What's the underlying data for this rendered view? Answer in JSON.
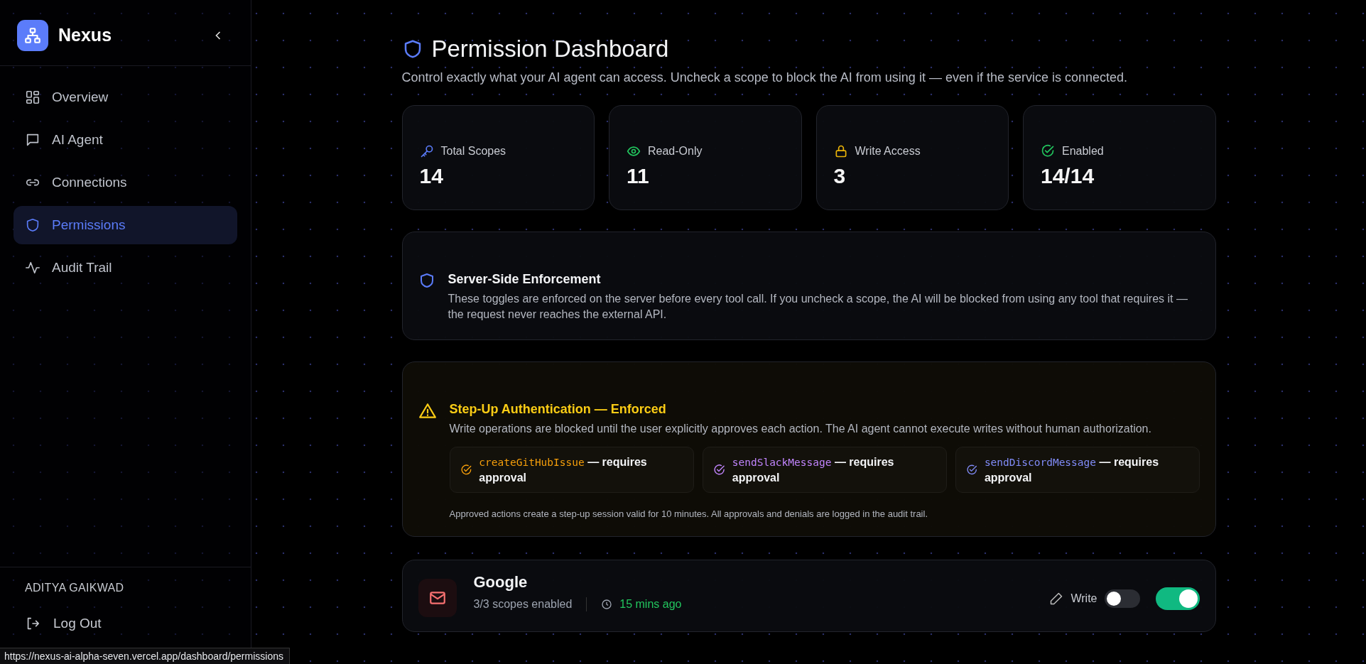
{
  "sidebar": {
    "brand": "Nexus",
    "items": [
      {
        "label": "Overview",
        "kind": "grid",
        "selected": false
      },
      {
        "label": "AI Agent",
        "kind": "chat",
        "selected": false
      },
      {
        "label": "Connections",
        "kind": "link",
        "selected": false
      },
      {
        "label": "Permissions",
        "kind": "shield",
        "selected": true
      },
      {
        "label": "Audit Trail",
        "kind": "pulse",
        "selected": false
      }
    ],
    "user": "ADITYA GAIKWAD",
    "logout": "Log Out"
  },
  "header": {
    "title": "Permission Dashboard",
    "subtitle": "Control exactly what your AI agent can access. Uncheck a scope to block the AI from using it — even if the service is connected."
  },
  "stats": [
    {
      "kind": "key",
      "label": "Total Scopes",
      "value": "14",
      "color": "#5b7cfa"
    },
    {
      "kind": "eye",
      "label": "Read-Only",
      "value": "11",
      "color": "#22c55e"
    },
    {
      "kind": "lock",
      "label": "Write Access",
      "value": "3",
      "color": "#eab308"
    },
    {
      "kind": "check",
      "label": "Enabled",
      "value": "14/14",
      "color": "#22c55e"
    }
  ],
  "enforcement": {
    "title": "Server-Side Enforcement",
    "text": "These toggles are enforced on the server before every tool call. If you uncheck a scope, the AI will be blocked from using any tool that requires it — the request never reaches the external API."
  },
  "step_up": {
    "title": "Step-Up Authentication — Enforced",
    "text": "Write operations are blocked until the user explicitly approves each action. The AI agent cannot execute writes without human authorization.",
    "actions": [
      {
        "name": "createGitHubIssue",
        "suffix": "— requires approval",
        "color": "#f59e0b"
      },
      {
        "name": "sendSlackMessage",
        "suffix": "— requires approval",
        "color": "#c084fc"
      },
      {
        "name": "sendDiscordMessage",
        "suffix": "— requires approval",
        "color": "#818cf8"
      }
    ],
    "note": "Approved actions create a step-up session valid for 10 minutes. All approvals and denials are logged in the audit trail."
  },
  "services": [
    {
      "name": "Google",
      "scopes": "3/3 scopes enabled",
      "time": "15 mins ago",
      "write_label": "Write",
      "write_on": false,
      "on": true
    }
  ],
  "status_bar": "https://nexus-ai-alpha-seven.vercel.app/dashboard/permissions"
}
